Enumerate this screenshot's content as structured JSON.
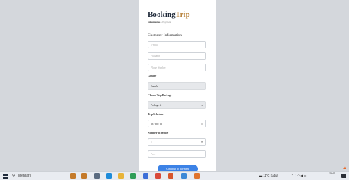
{
  "brand": {
    "part1": "Booking",
    "part2": "Trip"
  },
  "breadcrumb": {
    "step1": "Information",
    "separator": "›",
    "step2": "Payment"
  },
  "form": {
    "title": "Customer Information",
    "email_placeholder": "E-mail",
    "fullname_placeholder": "Fullname",
    "phone_placeholder": "Phone Number",
    "gender_label": "Gender",
    "gender_value": "Female",
    "package_label": "Choose Trip Package",
    "package_value": "Package A",
    "schedule_label": "Trip Schedule",
    "schedule_value": "hh / bb / tttt",
    "people_label": "Number of People",
    "people_value": "1",
    "price_placeholder": "Price",
    "submit_label": "Continue to payment"
  },
  "taskbar": {
    "search_label": "Mencari",
    "weather": "11°C Kabut",
    "clock_time": "15:47",
    "apps": [
      {
        "name": "people-icon",
        "color": "#c47a2a"
      },
      {
        "name": "people-icon",
        "color": "#c47a2a"
      },
      {
        "name": "task-view-icon",
        "color": "#5a6b80"
      },
      {
        "name": "edge-icon",
        "color": "#1e8bd9"
      },
      {
        "name": "file-explorer-icon",
        "color": "#e8b43a"
      },
      {
        "name": "chrome-icon",
        "color": "#2f9e58"
      },
      {
        "name": "store-icon",
        "color": "#3d6fd8"
      },
      {
        "name": "gmail-icon",
        "color": "#d94a3a"
      },
      {
        "name": "office-icon",
        "color": "#d8562c"
      },
      {
        "name": "photos-icon",
        "color": "#3b88d6"
      },
      {
        "name": "xampp-icon",
        "color": "#e0742c"
      }
    ]
  },
  "colors": {
    "accent": "#b9853f",
    "cta": "#3c82e6"
  }
}
